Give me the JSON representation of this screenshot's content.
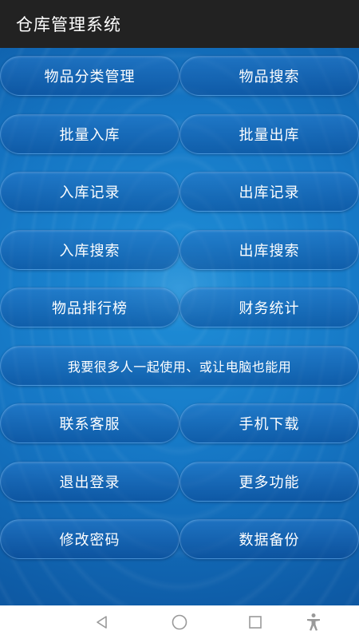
{
  "app": {
    "title": "仓库管理系统"
  },
  "menu": {
    "rows": [
      [
        "物品分类管理",
        "物品搜索"
      ],
      [
        "批量入库",
        "批量出库"
      ],
      [
        "入库记录",
        "出库记录"
      ],
      [
        "入库搜索",
        "出库搜索"
      ],
      [
        "物品排行榜",
        "财务统计"
      ],
      [
        "我要很多人一起使用、或让电脑也能用"
      ],
      [
        "联系客服",
        "手机下载"
      ],
      [
        "退出登录",
        "更多功能"
      ],
      [
        "修改密码",
        "数据备份"
      ]
    ]
  },
  "nav_icons": [
    "back-icon",
    "home-icon",
    "recents-icon",
    "accessibility-icon"
  ],
  "colors": {
    "titlebar": "#222222",
    "content_blue": "#1576c4",
    "button_text": "#ffffff",
    "nav_icon": "#999999"
  }
}
